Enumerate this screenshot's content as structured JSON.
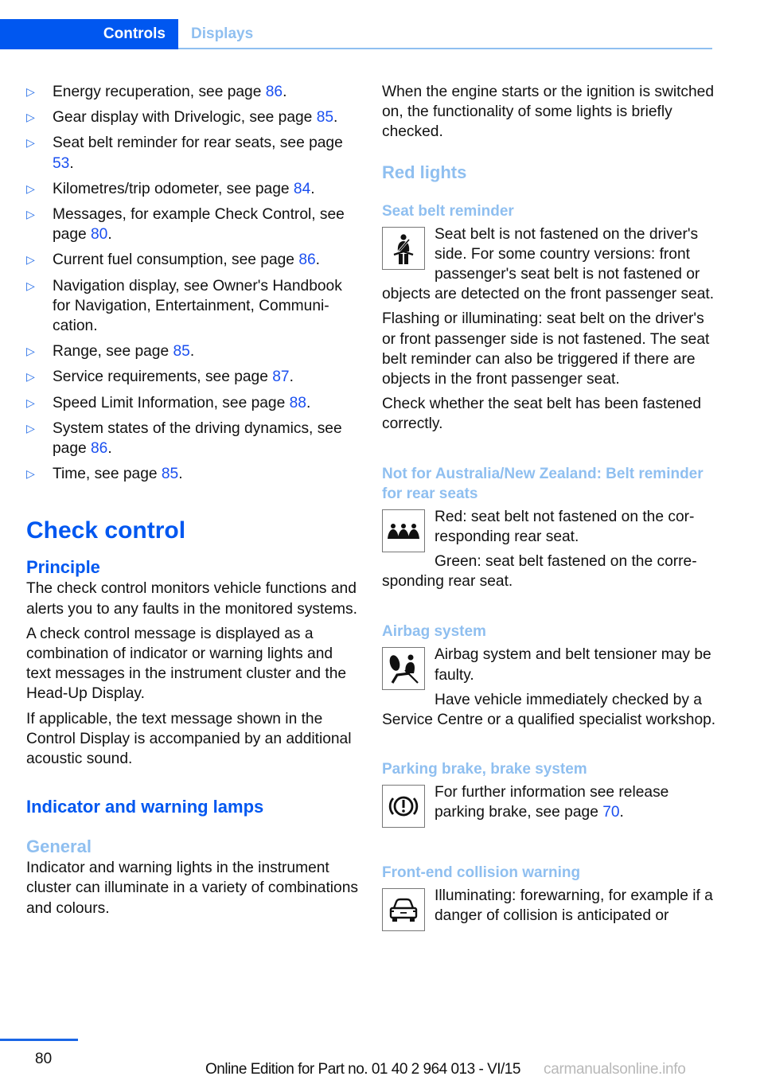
{
  "header": {
    "tabs": [
      {
        "label": "Controls",
        "active": true
      },
      {
        "label": "Displays",
        "active": false
      }
    ]
  },
  "colors": {
    "accent": "#0057f0",
    "light_accent": "#8fbff0",
    "link": "#1a4ff0"
  },
  "left": {
    "bullets": [
      {
        "text": "Energy recuperation, see page ",
        "page": "86",
        "tail": "."
      },
      {
        "text": "Gear display with Drivelogic, see page ",
        "page": "85",
        "tail": "."
      },
      {
        "text": "Seat belt reminder for rear seats, see page ",
        "page": "53",
        "tail": "."
      },
      {
        "text": "Kilometres/trip odometer, see page ",
        "page": "84",
        "tail": "."
      },
      {
        "text": "Messages, for example Check Control, see page ",
        "page": "80",
        "tail": "."
      },
      {
        "text": "Current fuel consumption, see page ",
        "page": "86",
        "tail": "."
      },
      {
        "text": "Navigation display, see Owner's Handbook for Navigation, Entertainment, Communi­cation.",
        "page": null,
        "tail": ""
      },
      {
        "text": "Range, see page ",
        "page": "85",
        "tail": "."
      },
      {
        "text": "Service requirements, see page ",
        "page": "87",
        "tail": "."
      },
      {
        "text": "Speed Limit Information, see page ",
        "page": "88",
        "tail": "."
      },
      {
        "text": "System states of the driving dynamics, see page ",
        "page": "86",
        "tail": "."
      },
      {
        "text": "Time, see page ",
        "page": "85",
        "tail": "."
      }
    ],
    "section_title": "Check control",
    "principle_title": "Principle",
    "principle_paras": [
      "The check control monitors vehicle functions and alerts you to any faults in the monitored systems.",
      "A check control message is displayed as a combination of indicator or warning lights and text messages in the instrument cluster and the Head-Up Display.",
      "If applicable, the text message shown in the Control Display is accompanied by an addi­tional acoustic sound."
    ],
    "lamps_title": "Indicator and warning lamps",
    "general_title": "General",
    "general_para": "Indicator and warning lights in the instrument cluster can illuminate in a variety of combina­tions and colours."
  },
  "right": {
    "intro": "When the engine starts or the ignition is switched on, the functionality of some lights is briefly checked.",
    "red_lights_title": "Red lights",
    "seatbelt": {
      "title": "Seat belt reminder",
      "icon": "seatbelt-icon",
      "paras": [
        "Seat belt is not fastened on the driver's side. For some country versions: front passenger's seat belt is not fastened or objects are detected on the front passenger seat.",
        "Flashing or illuminating: seat belt on the driv­er's or front passenger side is not fastened. The seat belt reminder can also be triggered if there are objects in the front passenger seat.",
        "Check whether the seat belt has been fas­tened correctly."
      ]
    },
    "rear_belt": {
      "title": "Not for Australia/New Zealand: Belt reminder for rear seats",
      "icon": "rear-seats-icon",
      "paras": [
        "Red: seat belt not fastened on the cor­responding rear seat.",
        "Green: seat belt fastened on the corre­sponding rear seat."
      ]
    },
    "airbag": {
      "title": "Airbag system",
      "icon": "airbag-icon",
      "paras": [
        "Airbag system and belt tensioner may be faulty.",
        "Have vehicle immediately checked by a Service Centre or a qualified specialist work­shop."
      ]
    },
    "parking_brake": {
      "title": "Parking brake, brake system",
      "icon": "brake-warning-icon",
      "text": "For further information see release parking brake, see page ",
      "page": "70",
      "tail": "."
    },
    "collision": {
      "title": "Front-end collision warning",
      "icon": "car-front-icon",
      "text": "Illuminating: forewarning, for example if a danger of collision is anticipated or"
    }
  },
  "footer": {
    "page_number": "80",
    "edition": "Online Edition for Part no. 01 40 2 964 013 - VI/15",
    "watermark": "carmanualsonline.info"
  }
}
